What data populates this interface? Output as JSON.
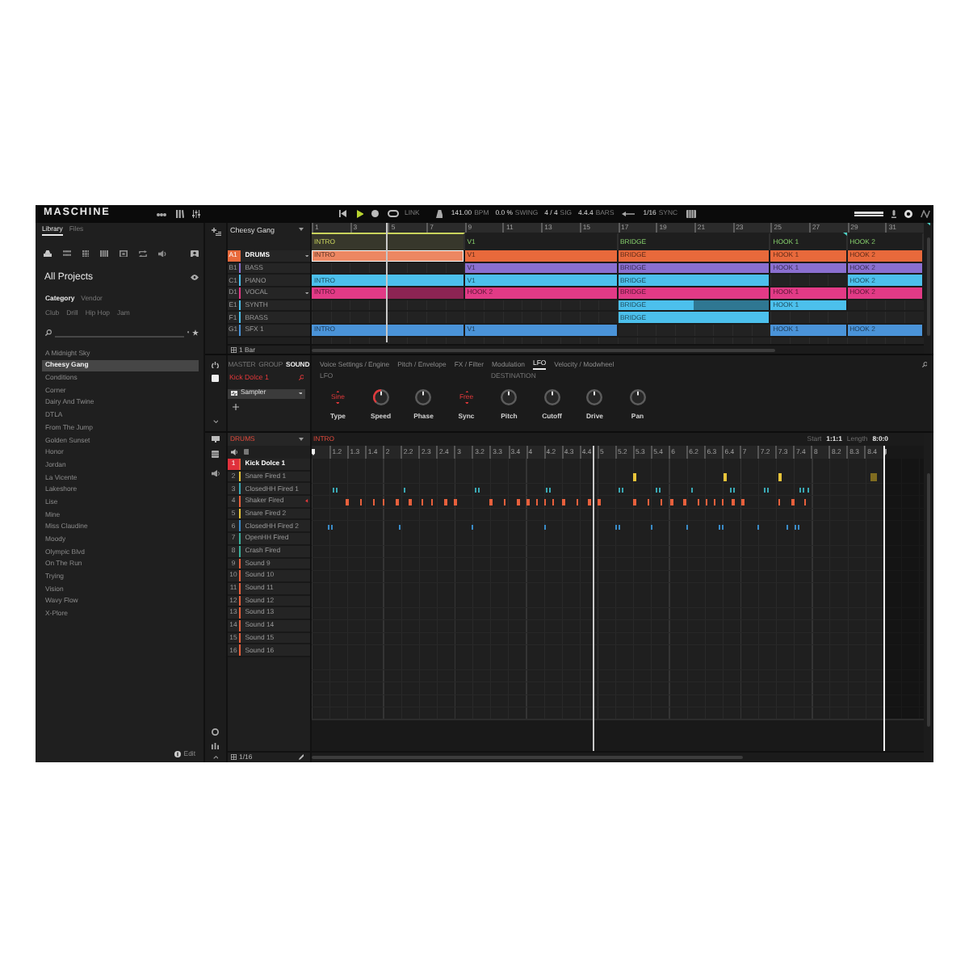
{
  "topbar": {
    "logo": "MASCHINE",
    "playing": true,
    "link": "LINK",
    "tempo": "141.00",
    "tempo_unit": "BPM",
    "swing": "0.0 %",
    "swing_unit": "SWING",
    "signature": "4 / 4",
    "signature_unit": "SIG",
    "bars": "4.4.4",
    "bars_unit": "BARS",
    "sync": "1/16",
    "sync_unit": "SYNC"
  },
  "library": {
    "tabs": [
      {
        "label": "Library",
        "selected": true
      },
      {
        "label": "Files",
        "selected": false
      }
    ],
    "title": "All Projects",
    "filters": [
      {
        "label": "Category",
        "selected": true
      },
      {
        "label": "Vendor",
        "selected": false
      }
    ],
    "tags": [
      "Club",
      "Drill",
      "Hip Hop",
      "Jam"
    ],
    "items": [
      {
        "label": "A Midnight Sky",
        "selected": false
      },
      {
        "label": "Cheesy Gang",
        "selected": true
      },
      {
        "label": "Conditions",
        "selected": false
      },
      {
        "label": "Corner",
        "selected": false
      },
      {
        "label": "Dairy And Twine",
        "selected": false
      },
      {
        "label": "DTLA",
        "selected": false
      },
      {
        "label": "From The Jump",
        "selected": false
      },
      {
        "label": "Golden Sunset",
        "selected": false
      },
      {
        "label": "Honor",
        "selected": false
      },
      {
        "label": "Jordan",
        "selected": false
      },
      {
        "label": "La Vicente",
        "selected": false
      },
      {
        "label": "Lakeshore",
        "selected": false
      },
      {
        "label": "Lise",
        "selected": false
      },
      {
        "label": "Mine",
        "selected": false
      },
      {
        "label": "Miss Claudine",
        "selected": false
      },
      {
        "label": "Moody",
        "selected": false
      },
      {
        "label": "Olympic Blvd",
        "selected": false
      },
      {
        "label": "On The Run",
        "selected": false
      },
      {
        "label": "Trying",
        "selected": false
      },
      {
        "label": "Vision",
        "selected": false
      },
      {
        "label": "Wavy Flow",
        "selected": false
      },
      {
        "label": "X-Plore",
        "selected": false
      }
    ],
    "edit": "Edit"
  },
  "arranger": {
    "title": "Cheesy Gang",
    "ruler": [
      "1",
      "3",
      "5",
      "7",
      "9",
      "11",
      "13",
      "15",
      "17",
      "19",
      "21",
      "23",
      "25",
      "27",
      "29",
      "31"
    ],
    "sections": [
      {
        "label": "INTRO",
        "selected": true
      },
      {
        "label": "V1",
        "selected": false
      },
      {
        "label": "BRIDGE",
        "selected": false
      },
      {
        "label": "HOOK 1",
        "selected": false
      },
      {
        "label": "HOOK 2",
        "selected": false
      }
    ],
    "tracks": [
      {
        "slot": "A1",
        "name": "DRUMS",
        "color": "#e8693b",
        "selected": true,
        "marked": true,
        "clips": [
          {
            "kind": "clip",
            "label": "INTRO",
            "selected": true
          },
          {
            "kind": "clip",
            "label": "V1",
            "selected": false
          },
          {
            "kind": "clip",
            "label": "BRIDGE",
            "selected": false
          },
          {
            "kind": "clip",
            "label": "HOOK 1",
            "selected": false
          },
          {
            "kind": "clip",
            "label": "HOOK 2",
            "selected": false
          }
        ]
      },
      {
        "slot": "B1",
        "name": "BASS",
        "color": "#8a6fd0",
        "selected": false,
        "marked": false,
        "clips": [
          {
            "kind": "empty"
          },
          {
            "kind": "clip",
            "label": "V1",
            "selected": false
          },
          {
            "kind": "clip",
            "label": "BRIDGE",
            "selected": false
          },
          {
            "kind": "clip",
            "label": "HOOK 1",
            "selected": false
          },
          {
            "kind": "clip",
            "label": "HOOK 2",
            "selected": false
          }
        ]
      },
      {
        "slot": "C1",
        "name": "PIANO",
        "color": "#4cc0ec",
        "selected": false,
        "marked": false,
        "clips": [
          {
            "kind": "clip",
            "label": "INTRO",
            "selected": false
          },
          {
            "kind": "clip",
            "label": "V1",
            "selected": false
          },
          {
            "kind": "clip",
            "label": "BRIDGE",
            "selected": false
          },
          {
            "kind": "empty"
          },
          {
            "kind": "clip",
            "label": "HOOK 2",
            "selected": false
          }
        ]
      },
      {
        "slot": "D1",
        "name": "VOCAL",
        "color": "#e23a86",
        "selected": false,
        "marked": true,
        "clips": [
          {
            "kind": "clip_loop",
            "label": "INTRO",
            "selected": false
          },
          {
            "kind": "clip",
            "label": "HOOK 2",
            "selected": false
          },
          {
            "kind": "clip",
            "label": "BRIDGE",
            "selected": false
          },
          {
            "kind": "clip",
            "label": "HOOK 1",
            "selected": false
          },
          {
            "kind": "clip",
            "label": "HOOK 2",
            "selected": false
          }
        ]
      },
      {
        "slot": "E1",
        "name": "SYNTH",
        "color": "#4cc0ec",
        "selected": false,
        "marked": false,
        "clips": [
          {
            "kind": "empty"
          },
          {
            "kind": "empty"
          },
          {
            "kind": "clip_loop",
            "label": "BRIDGE",
            "selected": false
          },
          {
            "kind": "clip",
            "label": "HOOK 1",
            "selected": false
          },
          {
            "kind": "empty"
          }
        ]
      },
      {
        "slot": "F1",
        "name": "BRASS",
        "color": "#4cc0ec",
        "selected": false,
        "marked": false,
        "clips": [
          {
            "kind": "empty"
          },
          {
            "kind": "empty"
          },
          {
            "kind": "clip",
            "label": "BRIDGE",
            "selected": false
          },
          {
            "kind": "empty"
          },
          {
            "kind": "empty"
          }
        ]
      },
      {
        "slot": "G1",
        "name": "SFX 1",
        "color": "#4a93d8",
        "selected": false,
        "marked": false,
        "clips": [
          {
            "kind": "clip",
            "label": "INTRO",
            "selected": false
          },
          {
            "kind": "clip",
            "label": "V1",
            "selected": false
          },
          {
            "kind": "empty"
          },
          {
            "kind": "clip",
            "label": "HOOK 1",
            "selected": false
          },
          {
            "kind": "clip",
            "label": "HOOK 2",
            "selected": false
          }
        ]
      }
    ],
    "zoom": "1 Bar"
  },
  "sound": {
    "levels": [
      {
        "label": "MASTER",
        "selected": false
      },
      {
        "label": "GROUP",
        "selected": false
      },
      {
        "label": "SOUND",
        "selected": true
      }
    ],
    "name": "Kick Dolce 1",
    "plugin": "Sampler",
    "pages": [
      {
        "label": "Voice Settings / Engine",
        "selected": false
      },
      {
        "label": "Pitch / Envelope",
        "selected": false
      },
      {
        "label": "FX / Filter",
        "selected": false
      },
      {
        "label": "Modulation",
        "selected": false
      },
      {
        "label": "LFO",
        "selected": true
      },
      {
        "label": "Velocity / Modwheel",
        "selected": false
      }
    ],
    "lfo_label": "LFO",
    "destination_label": "DESTINATION",
    "controls": [
      {
        "kind": "stepper",
        "label": "Type",
        "value": "Sine"
      },
      {
        "kind": "knob",
        "label": "Speed",
        "level": 0.5,
        "bipolar": false
      },
      {
        "kind": "knob",
        "label": "Phase",
        "level": 0.5,
        "bipolar": true
      },
      {
        "kind": "stepper",
        "label": "Sync",
        "value": "Free"
      },
      {
        "kind": "knob",
        "label": "Pitch",
        "level": 0.5,
        "bipolar": true
      },
      {
        "kind": "knob",
        "label": "Cutoff",
        "level": 0.5,
        "bipolar": true
      },
      {
        "kind": "knob",
        "label": "Drive",
        "level": 0.5,
        "bipolar": true
      },
      {
        "kind": "knob",
        "label": "Pan",
        "level": 0.5,
        "bipolar": true
      }
    ]
  },
  "pattern": {
    "group": "DRUMS",
    "name": "INTRO",
    "start_label": "Start",
    "start": "1:1:1",
    "length_label": "Length",
    "length": "8:0:0",
    "ruler": [
      "1.2",
      "1.3",
      "1.4",
      "2",
      "2.2",
      "2.3",
      "2.4",
      "3",
      "3.2",
      "3.3",
      "3.4",
      "4",
      "4.2",
      "4.3",
      "4.4",
      "5",
      "5.2",
      "5.3",
      "5.4",
      "6",
      "6.2",
      "6.3",
      "6.4",
      "7",
      "7.2",
      "7.3",
      "7.4",
      "8",
      "8.2",
      "8.3",
      "8.4"
    ],
    "pads": [
      {
        "number": "1",
        "name": "Kick Dolce 1",
        "color": "#e8603c",
        "selected": true,
        "marked": false
      },
      {
        "number": "2",
        "name": "Snare Fired 1",
        "color": "#e8c43a",
        "selected": false,
        "marked": false
      },
      {
        "number": "3",
        "name": "ClosedHH Fired 1",
        "color": "#3aa8b4",
        "selected": false,
        "marked": false
      },
      {
        "number": "4",
        "name": "Shaker Fired",
        "color": "#e8603c",
        "selected": false,
        "marked": true
      },
      {
        "number": "5",
        "name": "Snare Fired 2",
        "color": "#e8c43a",
        "selected": false,
        "marked": false
      },
      {
        "number": "6",
        "name": "ClosedHH Fired 2",
        "color": "#3a8cc8",
        "selected": false,
        "marked": false
      },
      {
        "number": "7",
        "name": "OpenHH Fired",
        "color": "#3aae9a",
        "selected": false,
        "marked": false
      },
      {
        "number": "8",
        "name": "Crash Fired",
        "color": "#3aae9a",
        "selected": false,
        "marked": false
      },
      {
        "number": "9",
        "name": "Sound 9",
        "color": "#e8603c",
        "selected": false,
        "marked": false
      },
      {
        "number": "10",
        "name": "Sound 10",
        "color": "#e8603c",
        "selected": false,
        "marked": false
      },
      {
        "number": "11",
        "name": "Sound 11",
        "color": "#e8603c",
        "selected": false,
        "marked": false
      },
      {
        "number": "12",
        "name": "Sound 12",
        "color": "#e8603c",
        "selected": false,
        "marked": false
      },
      {
        "number": "13",
        "name": "Sound 13",
        "color": "#e8603c",
        "selected": false,
        "marked": false
      },
      {
        "number": "14",
        "name": "Sound 14",
        "color": "#e8603c",
        "selected": false,
        "marked": false
      },
      {
        "number": "15",
        "name": "Sound 15",
        "color": "#e8603c",
        "selected": false,
        "marked": false
      },
      {
        "number": "16",
        "name": "Sound 16",
        "color": "#e8603c",
        "selected": false,
        "marked": false
      }
    ],
    "grid": "1/16"
  }
}
